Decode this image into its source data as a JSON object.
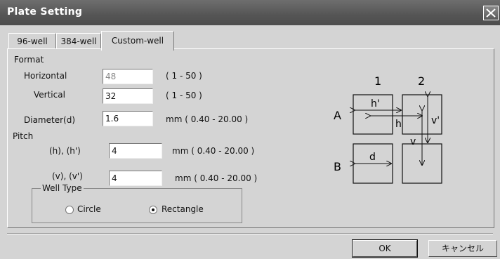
{
  "window": {
    "title": "Plate Setting"
  },
  "tabs": [
    {
      "label": "96-well"
    },
    {
      "label": "384-well"
    },
    {
      "label": "Custom-well",
      "active": true
    }
  ],
  "format": {
    "section_label": "Format",
    "horizontal": {
      "label": "Horizontal",
      "value": "48",
      "range": "( 1 - 50 )"
    },
    "vertical": {
      "label": "Vertical",
      "value": "32",
      "range": "( 1 - 50 )"
    },
    "diameter": {
      "label": "Diameter(d)",
      "value": "1.6",
      "range": "mm ( 0.40 - 20.00 )"
    }
  },
  "pitch": {
    "section_label": "Pitch",
    "h": {
      "label": "(h),   (h')",
      "value": "4",
      "range": "mm ( 0.40 - 20.00 )"
    },
    "v": {
      "label": "(v),   (v')",
      "value": "4",
      "range": "mm ( 0.40 - 20.00 )"
    }
  },
  "well_type": {
    "label": "Well Type",
    "options": [
      {
        "label": "Circle",
        "selected": false
      },
      {
        "label": "Rectangle",
        "selected": true
      }
    ]
  },
  "diagram": {
    "columns": [
      "1",
      "2"
    ],
    "rows": [
      "A",
      "B"
    ],
    "labels": {
      "h_prime": "h'",
      "h": "h",
      "v_prime": "v'",
      "v": "v",
      "d": "d"
    }
  },
  "buttons": {
    "ok": "OK",
    "cancel": "キャンセル"
  },
  "colors": {
    "titlebar": "#555555",
    "face": "#d4d4d4"
  }
}
